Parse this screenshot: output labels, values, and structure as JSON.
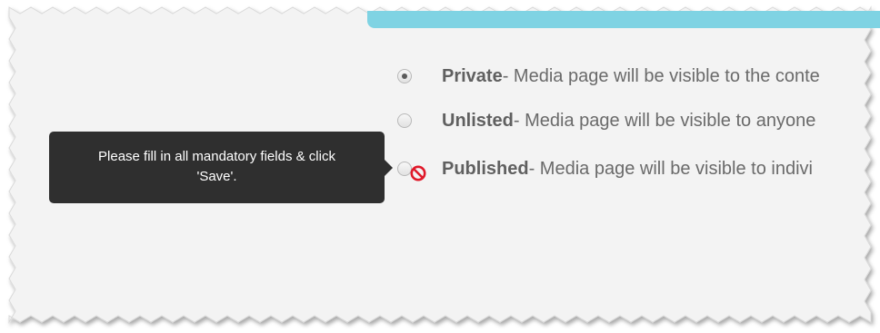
{
  "colors": {
    "page_background": "#f3f3f3",
    "accent": "#7fd3e3",
    "tooltip_background": "#2f2f2f",
    "no_entry": "#e0192a"
  },
  "visibility_options": [
    {
      "name": "Private",
      "description": " - Media page will be visible to the conte",
      "selected": true,
      "icon": "radio-selected-icon"
    },
    {
      "name": "Unlisted",
      "description": " - Media page will be visible to anyone",
      "selected": false,
      "icon": "radio-icon"
    },
    {
      "name": "Published",
      "description": " - Media page will be visible to indivi",
      "selected": false,
      "icon": "no-entry-icon"
    }
  ],
  "tooltip": {
    "line1": "Please fill in all mandatory fields & click",
    "line2": "'Save'."
  }
}
